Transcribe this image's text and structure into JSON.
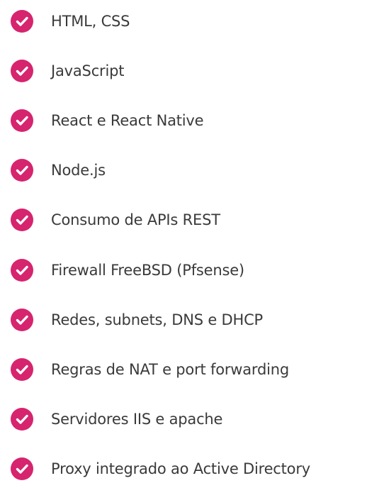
{
  "accent_color": "#d6246e",
  "skills": [
    {
      "label": "HTML, CSS",
      "icon": "check-icon"
    },
    {
      "label": "JavaScript",
      "icon": "check-icon"
    },
    {
      "label": "React e React Native",
      "icon": "check-icon"
    },
    {
      "label": "Node.js",
      "icon": "check-icon"
    },
    {
      "label": "Consumo de APIs REST",
      "icon": "check-icon"
    },
    {
      "label": "Firewall FreeBSD (Pfsense)",
      "icon": "check-icon"
    },
    {
      "label": "Redes, subnets, DNS e DHCP",
      "icon": "check-icon"
    },
    {
      "label": "Regras de NAT e port forwarding",
      "icon": "check-icon"
    },
    {
      "label": "Servidores IIS e apache",
      "icon": "check-icon"
    },
    {
      "label": "Proxy integrado ao Active Directory",
      "icon": "check-icon"
    }
  ]
}
